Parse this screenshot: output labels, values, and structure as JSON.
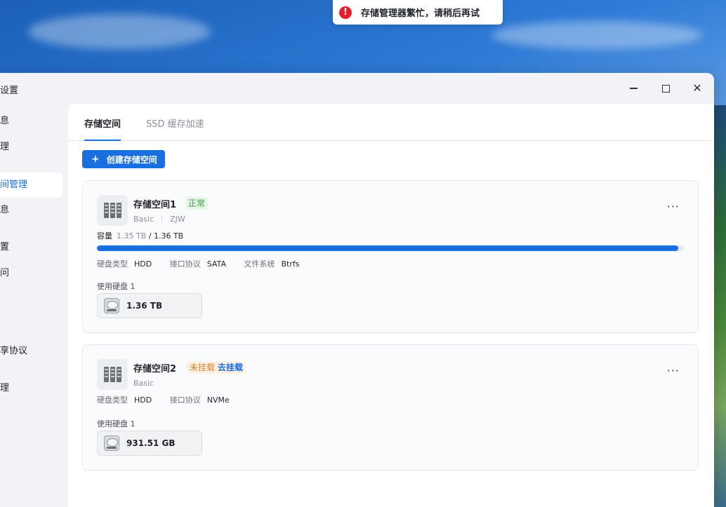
{
  "toast": {
    "message": "存储管理器繁忙，请稍后再试"
  },
  "window": {
    "title": "设置"
  },
  "sidebar": {
    "items": [
      {
        "label": "息"
      },
      {
        "label": "理"
      },
      {
        "label": "间管理"
      },
      {
        "label": "息"
      },
      {
        "label": "置"
      },
      {
        "label": "问"
      },
      {
        "label": "享协议"
      },
      {
        "label": "理"
      }
    ]
  },
  "tabs": [
    {
      "label": "存储空间"
    },
    {
      "label": "SSD 缓存加速"
    }
  ],
  "toolbar": {
    "create_plus": "+",
    "create_label": "创建存储空间"
  },
  "pools": [
    {
      "name": "存储空间1",
      "status": "正常",
      "raid": "Basic",
      "owner": "ZJW",
      "capacity_label": "容量",
      "used": "1.35 TB",
      "total": "/ 1.36 TB",
      "usage_fraction": 0.99,
      "disk_type_label": "硬盘类型",
      "disk_type": "HDD",
      "interface_label": "接口协议",
      "interface": "SATA",
      "fs_label": "文件系统",
      "fs": "Btrfs",
      "disks_label": "使用硬盘 1",
      "disk_size": "1.36 TB"
    },
    {
      "name": "存储空间2",
      "status": "未挂载",
      "mount_action": "去挂载",
      "raid": "Basic",
      "disk_type_label": "硬盘类型",
      "disk_type": "HDD",
      "interface_label": "接口协议",
      "interface": "NVMe",
      "disks_label": "使用硬盘 1",
      "disk_size": "931.51 GB"
    }
  ],
  "icons": {
    "error": "!",
    "close": "✕",
    "more": "···"
  },
  "colors": {
    "accent": "#1a6fe0",
    "error": "#e5202c",
    "ok": "#3a9d3f",
    "warn": "#d9812a"
  }
}
